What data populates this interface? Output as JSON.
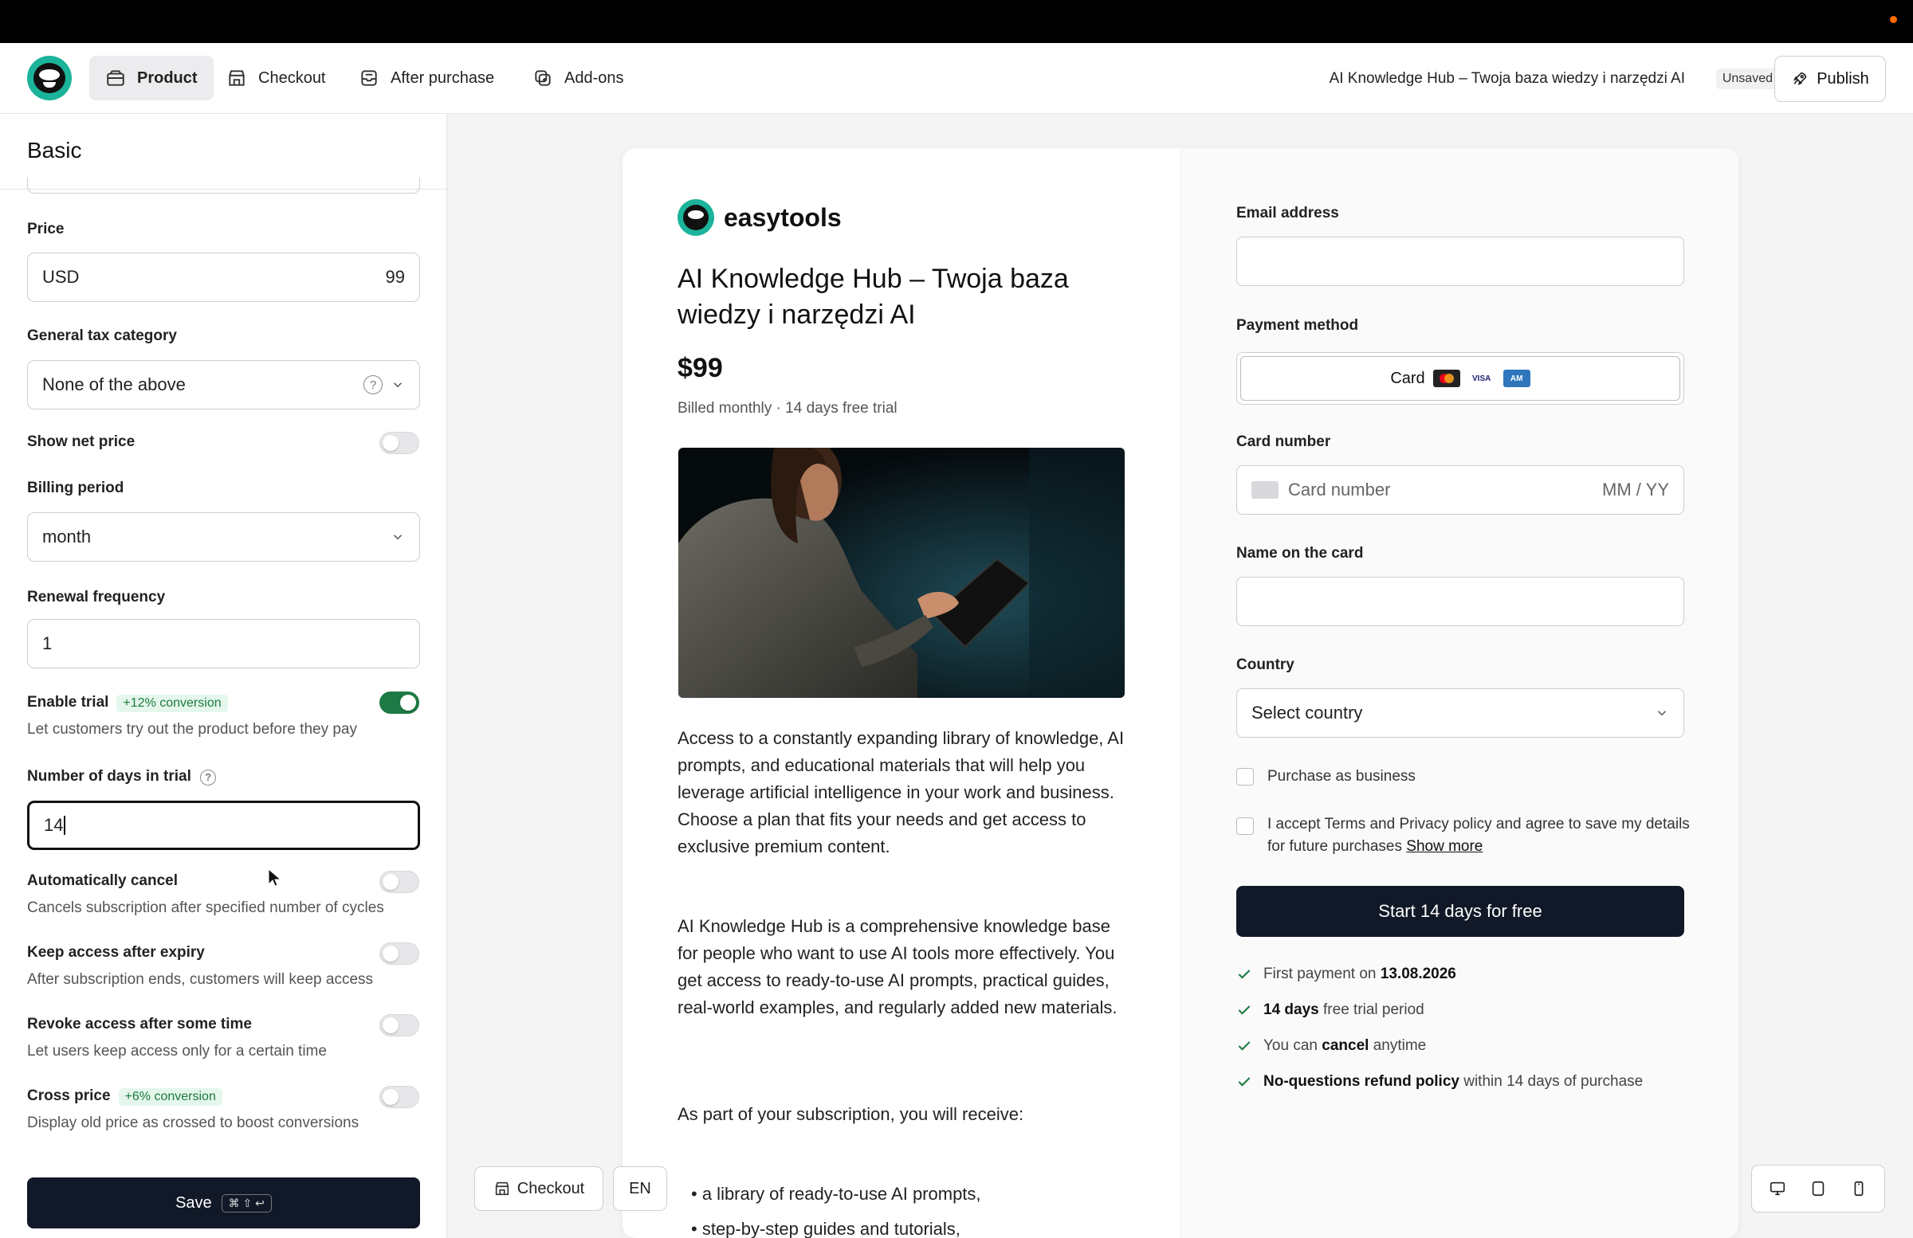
{
  "header": {
    "tabs": [
      {
        "label": "Product",
        "icon": "box-icon",
        "active": true
      },
      {
        "label": "Checkout",
        "icon": "store-icon",
        "active": false
      },
      {
        "label": "After purchase",
        "icon": "inbox-icon",
        "active": false
      },
      {
        "label": "Add-ons",
        "icon": "addons-icon",
        "active": false
      }
    ],
    "document_title": "AI Knowledge Hub – Twoja baza wiedzy i narzędzi AI",
    "status_badge": "Unsaved",
    "publish_label": "Publish"
  },
  "left_panel": {
    "section_title": "Basic",
    "price": {
      "label": "Price",
      "currency": "USD",
      "amount": "99"
    },
    "tax": {
      "label": "General tax category",
      "value": "None of the above"
    },
    "show_net_price": {
      "label": "Show net price",
      "enabled": false
    },
    "billing_period": {
      "label": "Billing period",
      "value": "month"
    },
    "renewal_frequency": {
      "label": "Renewal frequency",
      "value": "1"
    },
    "enable_trial": {
      "label": "Enable trial",
      "badge": "+12% conversion",
      "description": "Let customers try out the product before they pay",
      "enabled": true
    },
    "trial_days": {
      "label": "Number of days in trial",
      "value": "14"
    },
    "auto_cancel": {
      "label": "Automatically cancel",
      "description": "Cancels subscription after specified number of cycles",
      "enabled": false
    },
    "keep_access": {
      "label": "Keep access after expiry",
      "description": "After subscription ends, customers will keep access",
      "enabled": false
    },
    "revoke_access": {
      "label": "Revoke access after some time",
      "description": "Let users keep access only for a certain time",
      "enabled": false
    },
    "cross_price": {
      "label": "Cross price",
      "badge": "+6% conversion",
      "description": "Display old price as crossed to boost conversions",
      "enabled": false
    },
    "save_label": "Save",
    "save_shortcut": "⌘ ⇧ ↩"
  },
  "preview": {
    "brand_name": "easytools",
    "product_title": "AI Knowledge Hub – Twoja baza wiedzy i narzędzi AI",
    "price": "$99",
    "billing_note": "Billed monthly · 14 days free trial",
    "description_1": "Access to a constantly expanding library of knowledge, AI prompts, and educational materials that will help you leverage artificial intelligence in your work and business. Choose a plan that fits your needs and get access to exclusive premium content.",
    "description_2": "AI Knowledge Hub is a comprehensive knowledge base for people who want to use AI tools more effectively. You get access to ready-to-use AI prompts, practical guides, real-world examples, and regularly added new materials.",
    "description_3": "As part of your subscription, you will receive:",
    "bullets": [
      "a library of ready-to-use AI prompts,",
      "step-by-step guides and tutorials,"
    ],
    "form": {
      "email_label": "Email address",
      "payment_label": "Payment method",
      "payment_option": "Card",
      "card_label": "Card number",
      "card_placeholder": "Card number",
      "expiry_placeholder": "MM / YY",
      "name_label": "Name on the card",
      "country_label": "Country",
      "country_placeholder": "Select country",
      "business_label": "Purchase as business",
      "terms_text": "I accept Terms and Privacy policy and agree to save my details for future purchases",
      "show_more": "Show more",
      "cta": "Start 14 days for free",
      "perks": [
        {
          "pre": "First payment on",
          "bold": "13.08.2026",
          "post": ""
        },
        {
          "pre": "",
          "bold": "14 days",
          "post": "free trial period"
        },
        {
          "pre": "You can",
          "bold": "cancel",
          "post": "anytime"
        },
        {
          "pre": "",
          "bold": "No-questions refund policy",
          "post": "within 14 days of purchase"
        }
      ]
    }
  },
  "floating": {
    "checkout_label": "Checkout",
    "language": "EN",
    "devices": [
      "desktop-icon",
      "tablet-icon",
      "mobile-icon"
    ]
  },
  "colors": {
    "brand": "#1bb39a",
    "toggle_on": "#1e7a45",
    "primary_button": "#111827",
    "badge_bg": "#e5f7ec",
    "badge_text": "#1b7a3e"
  }
}
